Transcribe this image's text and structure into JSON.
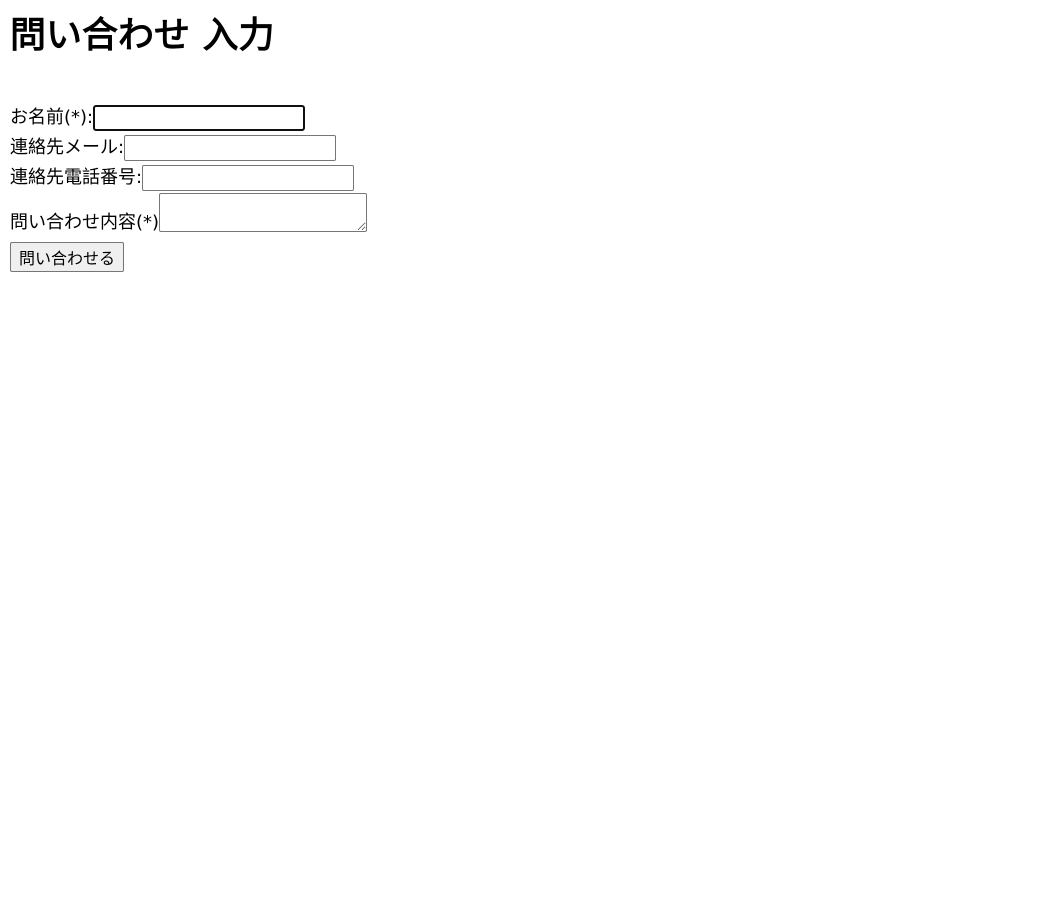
{
  "page": {
    "title": "問い合わせ 入力"
  },
  "form": {
    "name": {
      "label": "お名前(*):",
      "value": "",
      "focused": true
    },
    "email": {
      "label": "連絡先メール:",
      "value": ""
    },
    "phone": {
      "label": "連絡先電話番号:",
      "value": ""
    },
    "inquiry": {
      "label": "問い合わせ内容(*)",
      "value": ""
    },
    "submit_label": "問い合わせる"
  }
}
